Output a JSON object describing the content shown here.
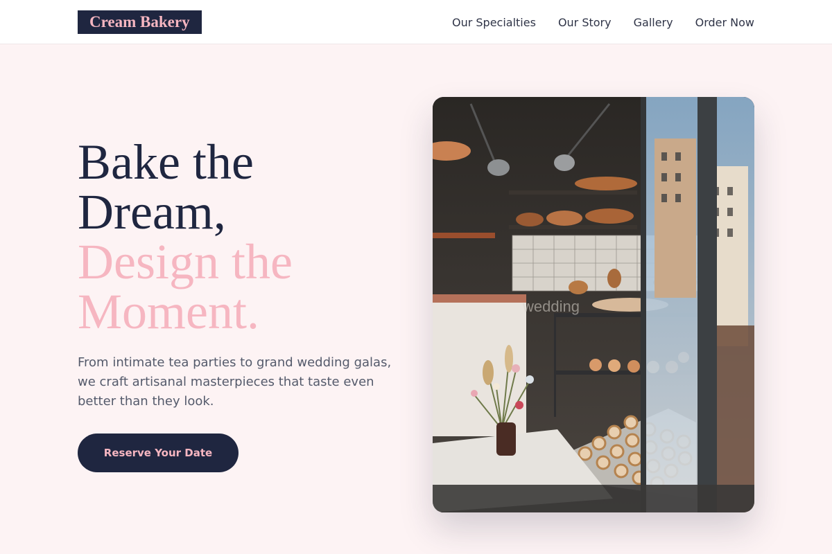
{
  "brand": {
    "name": "Cream Bakery"
  },
  "nav": {
    "items": [
      "Our Specialties",
      "Our Story",
      "Gallery",
      "Order Now"
    ]
  },
  "hero": {
    "headline_line1": "Bake the",
    "headline_line2": "Dream,",
    "headline_line3": "Design the",
    "headline_line4": "Moment.",
    "subtext": "From intimate tea parties to grand wedding galas, we craft artisanal masterpieces that taste even better than they look.",
    "cta_label": "Reserve Your Date",
    "window_text": "wedding"
  },
  "colors": {
    "navy": "#1f2640",
    "pink": "#f6b6c1",
    "background": "#fdf3f4"
  }
}
